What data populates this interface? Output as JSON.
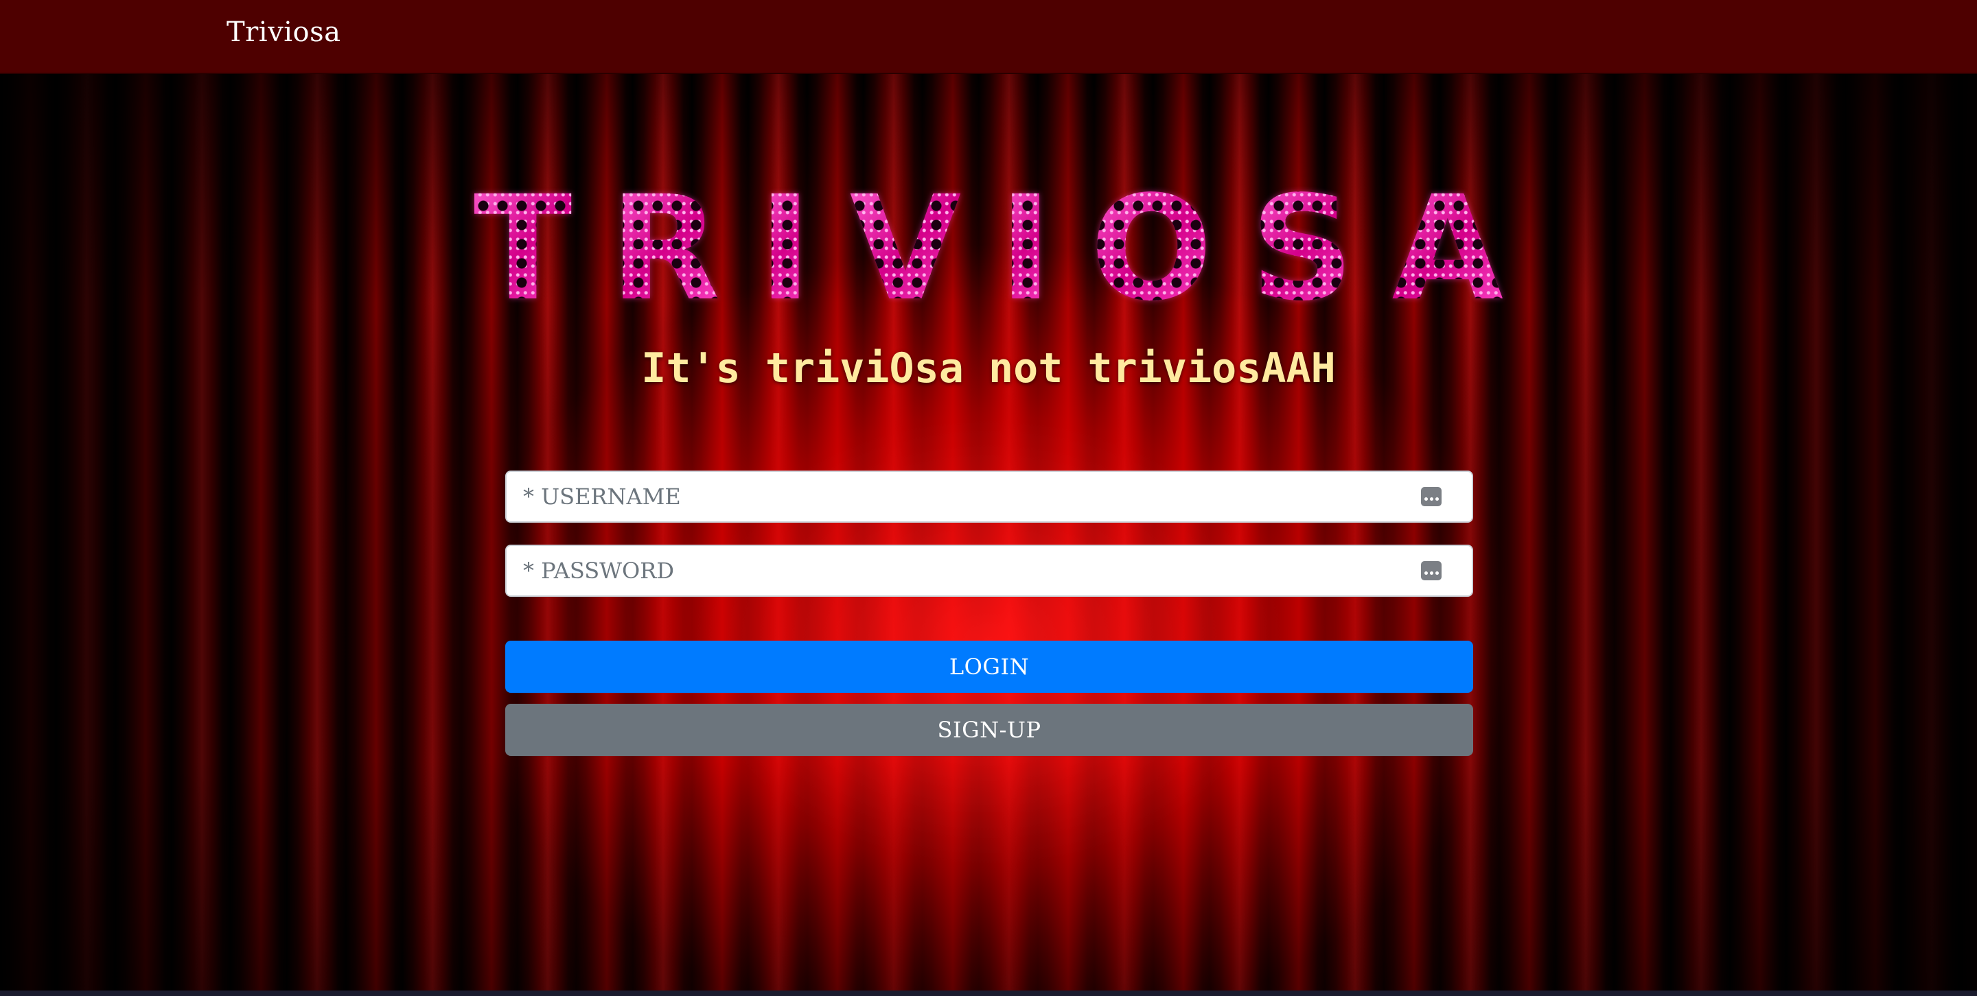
{
  "navbar": {
    "brand": "Triviosa",
    "background": "#4e0000"
  },
  "hero": {
    "logo_letters": [
      "T",
      "R",
      "I",
      "V",
      "I",
      "O",
      "S",
      "A"
    ],
    "logo_color": "#ff3cc0",
    "tagline": "It's triviOsa not triviosAAH",
    "tagline_color": "#ffeaa0"
  },
  "login_form": {
    "username": {
      "placeholder": "* USERNAME",
      "value": "",
      "icon": "autofill-key-icon"
    },
    "password": {
      "placeholder": "* PASSWORD",
      "value": "",
      "icon": "autofill-key-icon"
    },
    "login_label": "LOGIN",
    "login_color": "#007bff",
    "signup_label": "SIGN-UP",
    "signup_color": "#6c757d"
  },
  "background": {
    "theme": "red-theater-curtain"
  }
}
